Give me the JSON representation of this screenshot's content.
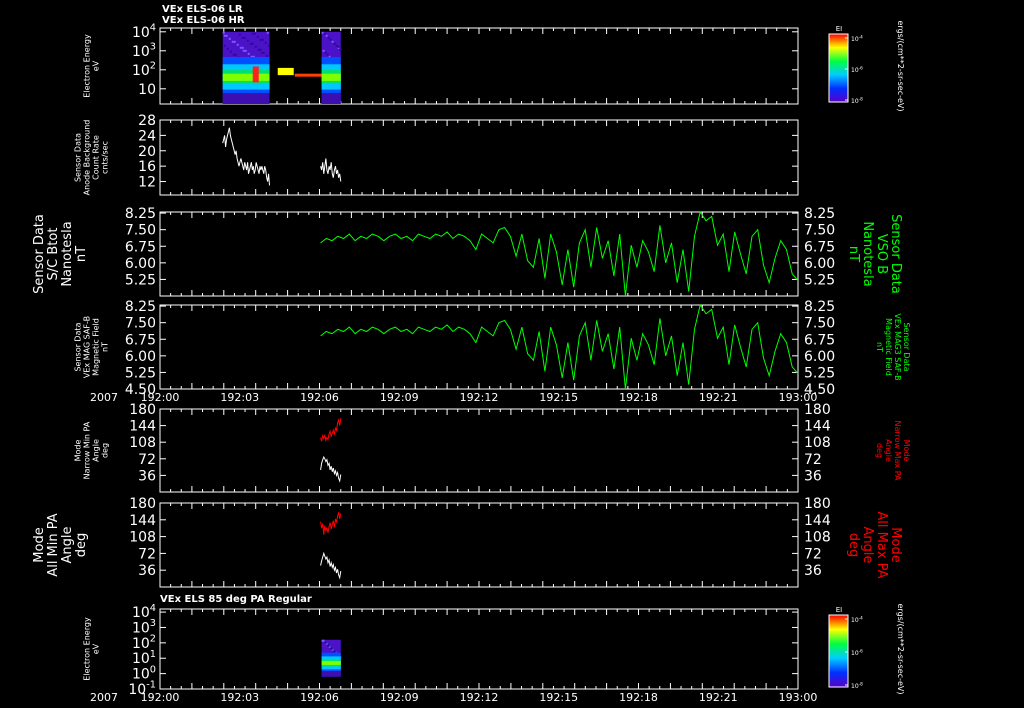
{
  "figure": {
    "headers": [
      "VEx ELS-06 LR",
      "VEx ELS-06 HR"
    ],
    "bottom_header": "VEx ELS 85 deg PA Regular",
    "colorbar_unit": "ergs/(cm**2-sr-sec-eV)",
    "time_axis": {
      "year_label": "2007",
      "ticks": [
        "192:00",
        "192:03",
        "192:06",
        "192:09",
        "192:12",
        "192:15",
        "192:18",
        "192:21",
        "193:00"
      ]
    }
  },
  "colors": {
    "background": "#000000",
    "axes": "#ffffff",
    "trace_white": "#ffffff",
    "trace_green": "#00ff00",
    "trace_red": "#ff0000",
    "spectrogram_bg": "#4b12c8"
  },
  "chart_data": [
    {
      "type": "heatmap",
      "id": "p1",
      "ylabel_lines": [
        "Electron Energy",
        "eV"
      ],
      "y_ticks": [
        {
          "base": "10",
          "exp": "4"
        },
        {
          "base": "10",
          "exp": "3"
        },
        {
          "base": "10",
          "exp": "2"
        },
        {
          "base": "10",
          "exp": ""
        }
      ],
      "colorbar": {
        "title": "EI",
        "ticks": [
          {
            "base": "10",
            "exp": "-4"
          },
          {
            "base": "10",
            "exp": "-6"
          },
          {
            "base": "10",
            "exp": "-8"
          }
        ]
      },
      "x_range": [
        0,
        60
      ],
      "y_range": [
        0.2,
        4.2
      ],
      "blocks": [
        {
          "t_start": 5.9,
          "t_end": 10.3,
          "y_min": 0.2,
          "y_max": 4.0
        },
        {
          "t_start": 15.2,
          "t_end": 17.0,
          "y_min": 0.2,
          "y_max": 4.0
        }
      ]
    },
    {
      "type": "line",
      "id": "p2",
      "ylabel_lines": [
        "Sensor Data",
        "Anode Background",
        "Count Rate",
        "cnts/sec"
      ],
      "y_ticks": [
        "28",
        "24",
        "20",
        "16",
        "12"
      ],
      "ylim": [
        8.5,
        28
      ],
      "series": [
        {
          "color": "white",
          "segments": [
            {
              "t_start": 5.9,
              "t_end": 10.3,
              "values": [
                22,
                23,
                24,
                21,
                23,
                24,
                25,
                26,
                24,
                23,
                22,
                21,
                20,
                19,
                20,
                18,
                17,
                16,
                17,
                18,
                17,
                16,
                15,
                17,
                16,
                15,
                17,
                14,
                15,
                16,
                17,
                15,
                16,
                14,
                15,
                17,
                16,
                15,
                14,
                16,
                15,
                16,
                15,
                14,
                16,
                15,
                13,
                12,
                14,
                11
              ]
            },
            {
              "t_start": 15.1,
              "t_end": 17.0,
              "values": [
                16,
                15,
                17,
                14,
                16,
                18,
                15,
                14,
                16,
                15,
                17,
                14,
                13,
                15,
                16,
                14,
                15,
                13,
                14,
                12
              ]
            }
          ]
        }
      ]
    },
    {
      "type": "line",
      "id": "p3",
      "ylabel_lines": [
        "Sensor Data",
        "S/C Btot",
        "Nanotesla",
        "nT"
      ],
      "rlabel_lines": [
        "Sensor Data",
        "VSO B",
        "Nanotesla",
        "nT"
      ],
      "y_ticks": [
        "8.25",
        "7.50",
        "6.75",
        "6.00",
        "5.25"
      ],
      "right_ticks": [
        "8.25",
        "7.50",
        "6.75",
        "6.00",
        "5.25"
      ],
      "ylim": [
        4.5,
        8.3
      ],
      "series": [
        {
          "color": "green",
          "segments": [
            {
              "t_start": 15.1,
              "t_end": 60.0,
              "values": [
                6.9,
                7.1,
                7.0,
                7.2,
                7.1,
                7.3,
                7.0,
                7.2,
                7.1,
                7.3,
                7.2,
                7.0,
                7.2,
                7.3,
                7.1,
                7.2,
                7.0,
                7.3,
                7.2,
                7.1,
                7.3,
                7.2,
                7.4,
                7.1,
                7.3,
                7.2,
                7.0,
                6.6,
                7.3,
                7.1,
                6.9,
                7.5,
                7.6,
                7.2,
                6.3,
                7.3,
                6.1,
                5.8,
                7.1,
                5.3,
                7.3,
                6.5,
                5.0,
                6.6,
                4.9,
                6.9,
                7.5,
                5.8,
                7.6,
                6.2,
                7.0,
                5.4,
                7.3,
                4.5,
                6.8,
                5.8,
                7.0,
                6.5,
                5.6,
                7.7,
                6.0,
                6.9,
                5.1,
                6.6,
                4.7,
                7.2,
                8.3,
                7.9,
                8.1,
                6.8,
                7.3,
                5.6,
                7.4,
                6.4,
                5.5,
                7.2,
                7.5,
                5.9,
                5.1,
                6.2,
                7.0,
                6.6,
                5.5,
                5.2
              ]
            }
          ]
        }
      ]
    },
    {
      "type": "line",
      "id": "p4",
      "ylabel_lines": [
        "Sensor Data",
        "VEx MAG SAF-B",
        "Magnetic Field",
        "nT"
      ],
      "rlabel_lines": [
        "Sensor Data",
        "VEx MAG3 SAF-B",
        "Magnetic Field",
        "nT"
      ],
      "y_ticks": [
        "8.25",
        "7.50",
        "6.75",
        "6.00",
        "5.25",
        "4.50"
      ],
      "right_ticks": [
        "8.25",
        "7.50",
        "6.75",
        "6.00",
        "5.25",
        "4.50"
      ],
      "ylim": [
        4.5,
        8.3
      ],
      "series": [
        {
          "color": "green",
          "segments": [
            {
              "t_start": 15.1,
              "t_end": 60.0,
              "values": [
                6.9,
                7.1,
                7.0,
                7.2,
                7.1,
                7.3,
                7.0,
                7.2,
                7.1,
                7.3,
                7.2,
                7.0,
                7.2,
                7.3,
                7.1,
                7.2,
                7.0,
                7.3,
                7.2,
                7.1,
                7.3,
                7.2,
                7.4,
                7.1,
                7.3,
                7.2,
                7.0,
                6.6,
                7.3,
                7.1,
                6.9,
                7.5,
                7.6,
                7.2,
                6.3,
                7.3,
                6.1,
                5.8,
                7.1,
                5.3,
                7.3,
                6.5,
                5.0,
                6.6,
                4.9,
                6.9,
                7.5,
                5.8,
                7.6,
                6.2,
                7.0,
                5.4,
                7.3,
                4.5,
                6.8,
                5.8,
                7.0,
                6.5,
                5.6,
                7.7,
                6.0,
                6.9,
                5.1,
                6.6,
                4.7,
                7.2,
                8.3,
                7.9,
                8.1,
                6.8,
                7.3,
                5.6,
                7.4,
                6.4,
                5.5,
                7.2,
                7.5,
                5.9,
                5.1,
                6.2,
                7.0,
                6.6,
                5.5,
                5.2
              ]
            }
          ]
        }
      ]
    },
    {
      "type": "line",
      "id": "p5",
      "ylabel_lines": [
        "Mode",
        "Narrow Min PA",
        "Angle",
        "deg"
      ],
      "rlabel_lines": [
        "Mode",
        "Narrow Max PA",
        "Angle",
        "deg"
      ],
      "y_ticks": [
        "180",
        "144",
        "108",
        "72",
        "36"
      ],
      "right_ticks": [
        "180",
        "144",
        "108",
        "72",
        "36"
      ],
      "ylim": [
        0,
        180
      ],
      "series": [
        {
          "color": "white",
          "segments": [
            {
              "t_start": 15.1,
              "t_end": 17.0,
              "values": [
                48,
                62,
                70,
                76,
                72,
                66,
                70,
                58,
                62,
                48,
                56,
                44,
                52,
                40,
                46,
                36,
                42,
                30,
                24,
                38
              ]
            }
          ]
        },
        {
          "color": "red",
          "segments": [
            {
              "t_start": 15.1,
              "t_end": 17.0,
              "values": [
                118,
                110,
                122,
                116,
                124,
                112,
                118,
                114,
                126,
                132,
                120,
                128,
                134,
                124,
                140,
                132,
                150,
                156,
                144,
                160
              ]
            }
          ]
        }
      ]
    },
    {
      "type": "line",
      "id": "p6",
      "ylabel_lines": [
        "Mode",
        "All Min PA",
        "Angle",
        "deg"
      ],
      "rlabel_lines": [
        "Mode",
        "All Max PA",
        "Angle",
        "deg"
      ],
      "y_ticks": [
        "180",
        "144",
        "108",
        "72",
        "36"
      ],
      "right_ticks": [
        "180",
        "144",
        "108",
        "72",
        "36"
      ],
      "ylim": [
        0,
        180
      ],
      "series": [
        {
          "color": "white",
          "segments": [
            {
              "t_start": 15.1,
              "t_end": 17.0,
              "values": [
                46,
                56,
                64,
                72,
                66,
                60,
                64,
                52,
                58,
                44,
                52,
                42,
                48,
                36,
                42,
                30,
                38,
                26,
                20,
                34
              ]
            }
          ]
        },
        {
          "color": "red",
          "segments": [
            {
              "t_start": 15.1,
              "t_end": 17.0,
              "values": [
                140,
                126,
                136,
                112,
                132,
                120,
                128,
                116,
                130,
                138,
                124,
                134,
                142,
                128,
                146,
                138,
                152,
                160,
                146,
                158
              ]
            }
          ]
        }
      ]
    },
    {
      "type": "heatmap",
      "id": "p7",
      "ylabel_lines": [
        "Electron Energy",
        "eV"
      ],
      "y_ticks": [
        {
          "base": "10",
          "exp": "4"
        },
        {
          "base": "10",
          "exp": "3"
        },
        {
          "base": "10",
          "exp": "2"
        },
        {
          "base": "10",
          "exp": "1"
        },
        {
          "base": "10",
          "exp": "0"
        },
        {
          "base": "10",
          "exp": "-1"
        }
      ],
      "colorbar": {
        "title": "EI",
        "ticks": [
          {
            "base": "10",
            "exp": "-4"
          },
          {
            "base": "10",
            "exp": "-6"
          },
          {
            "base": "10",
            "exp": "-8"
          }
        ]
      },
      "x_range": [
        0,
        60
      ],
      "y_range": [
        -1,
        4.2
      ],
      "blocks": [
        {
          "t_start": 15.2,
          "t_end": 17.0,
          "y_min": -0.2,
          "y_max": 2.2
        }
      ]
    }
  ]
}
